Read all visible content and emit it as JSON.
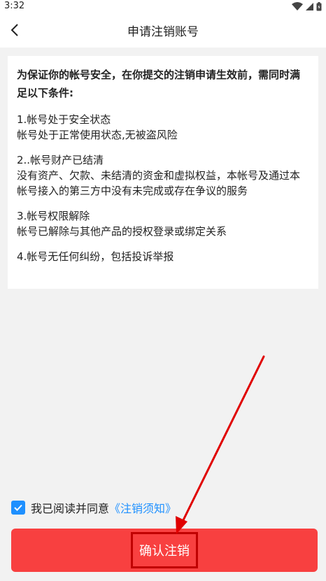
{
  "status_bar": {
    "time": "3:32",
    "icons": [
      "wifi-icon",
      "signal-icon",
      "battery-icon"
    ]
  },
  "header": {
    "title": "申请注销账号",
    "back_icon": "chevron-left-icon"
  },
  "content": {
    "heading": "为保证你的帐号安全，在你提交的注销申请生效前，需同时满足以下条件:",
    "conditions": [
      {
        "title": "1.帐号处于安全状态",
        "desc": "帐号处于正常使用状态,无被盗风险"
      },
      {
        "title": "2..帐号财产已结清",
        "desc": "没有资产、欠款、未结清的资金和虚拟权益，本帐号及通过本帐号接入的第三方中没有未完成或存在争议的服务"
      },
      {
        "title": "3.帐号权限解除",
        "desc": "帐号已解除与其他产品的授权登录或绑定关系"
      },
      {
        "title": "4.帐号无任何纠纷，包括投诉举报",
        "desc": ""
      }
    ]
  },
  "agreement": {
    "checked": true,
    "text": "我已阅读并同意",
    "link": "《注销须知》"
  },
  "confirm_button": {
    "label": "确认注销"
  },
  "colors": {
    "page_background": "#f2f2f2",
    "accent_blue": "#1e90ff",
    "button_red": "#f84040",
    "annotation_red": "#e00000"
  }
}
